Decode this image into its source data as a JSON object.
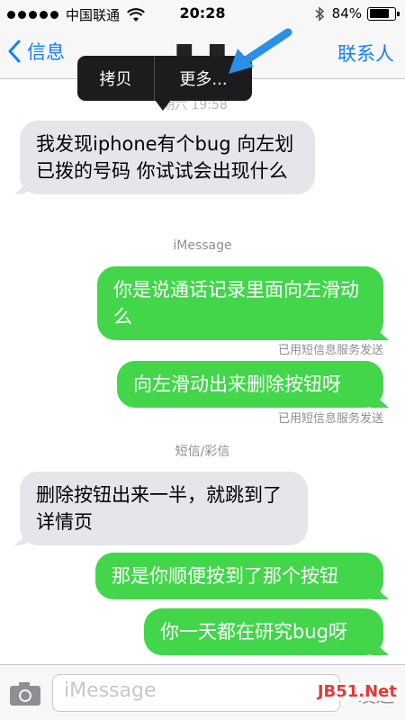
{
  "status_bar": {
    "carrier": "中国联通",
    "time": "20:28",
    "battery": "84%",
    "battery_level": 0.84
  },
  "nav": {
    "back_label": "信息",
    "title": "■ ■",
    "right_label": "联系人"
  },
  "callout": {
    "copy_label": "拷贝",
    "more_label": "更多..."
  },
  "timestamp_faint": "期六 19:58",
  "messages": [
    {
      "direction": "in",
      "text": "我发现iphone有个bug 向左划已拨的号码 你试试会出现什么"
    },
    {
      "type": "label",
      "text": "iMessage"
    },
    {
      "direction": "out",
      "text": "你是说通话记录里面向左滑动么",
      "status": "已用短信息服务发送"
    },
    {
      "direction": "out",
      "text": "向左滑动出来删除按钮呀",
      "status": "已用短信息服务发送"
    },
    {
      "type": "label",
      "text": "短信/彩信"
    },
    {
      "direction": "in",
      "text": "删除按钮出来一半，就跳到了详情页"
    },
    {
      "direction": "out",
      "text": "那是你顺便按到了那个按钮"
    },
    {
      "direction": "out",
      "text": "你一天都在研究bug呀"
    }
  ],
  "input": {
    "placeholder": "iMessage",
    "send_label": "发送"
  },
  "watermark": "JB51.Net",
  "colors": {
    "accent": "#157efb",
    "incoming_bubble": "#e5e5ea",
    "outgoing_bubble": "#43d64b",
    "callout": "#1c1c1e",
    "annotation_arrow": "#2a8fe6"
  },
  "icons": [
    "chevron-left-icon",
    "wifi-icon",
    "bluetooth-icon",
    "battery-icon",
    "camera-icon",
    "annotation-arrow-icon"
  ]
}
